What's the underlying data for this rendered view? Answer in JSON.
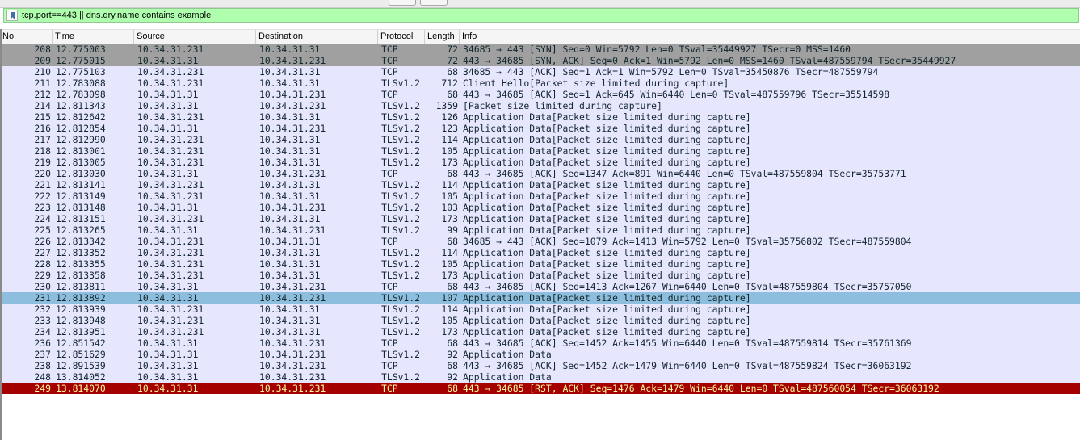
{
  "filter": {
    "value": "tcp.port==443 || dns.qry.name contains example"
  },
  "columns": [
    "No.",
    "Time",
    "Source",
    "Destination",
    "Protocol",
    "Length",
    "Info"
  ],
  "colors": {
    "filter_bg": "#afffaf",
    "tcp_bg": "#e7e6ff",
    "syn_bg": "#a0a0a0",
    "selected_bg": "#8ebedd",
    "rst_bg": "#a40000",
    "rst_fg": "#fffc9c"
  },
  "packets": [
    {
      "no": "208",
      "time": "12.775003",
      "src": "10.34.31.231",
      "dst": "10.34.31.31",
      "proto": "TCP",
      "len": "72",
      "info": "34685 → 443 [SYN] Seq=0 Win=5792 Len=0 TSval=35449927 TSecr=0 MSS=1460",
      "style": "syn"
    },
    {
      "no": "209",
      "time": "12.775015",
      "src": "10.34.31.31",
      "dst": "10.34.31.231",
      "proto": "TCP",
      "len": "72",
      "info": "443 → 34685 [SYN, ACK] Seq=0 Ack=1 Win=5792 Len=0 MSS=1460 TSval=487559794 TSecr=35449927",
      "style": "syn"
    },
    {
      "no": "210",
      "time": "12.775103",
      "src": "10.34.31.231",
      "dst": "10.34.31.31",
      "proto": "TCP",
      "len": "68",
      "info": "34685 → 443 [ACK] Seq=1 Ack=1 Win=5792 Len=0 TSval=35450876 TSecr=487559794",
      "style": "tcp"
    },
    {
      "no": "211",
      "time": "12.783088",
      "src": "10.34.31.231",
      "dst": "10.34.31.31",
      "proto": "TLSv1.2",
      "len": "712",
      "info": "Client Hello[Packet size limited during capture]",
      "style": "tls"
    },
    {
      "no": "212",
      "time": "12.783098",
      "src": "10.34.31.31",
      "dst": "10.34.31.231",
      "proto": "TCP",
      "len": "68",
      "info": "443 → 34685 [ACK] Seq=1 Ack=645 Win=6440 Len=0 TSval=487559796 TSecr=35514598",
      "style": "tcp"
    },
    {
      "no": "214",
      "time": "12.811343",
      "src": "10.34.31.31",
      "dst": "10.34.31.231",
      "proto": "TLSv1.2",
      "len": "1359",
      "info": "[Packet size limited during capture]",
      "style": "tls"
    },
    {
      "no": "215",
      "time": "12.812642",
      "src": "10.34.31.231",
      "dst": "10.34.31.31",
      "proto": "TLSv1.2",
      "len": "126",
      "info": "Application Data[Packet size limited during capture]",
      "style": "tls"
    },
    {
      "no": "216",
      "time": "12.812854",
      "src": "10.34.31.31",
      "dst": "10.34.31.231",
      "proto": "TLSv1.2",
      "len": "123",
      "info": "Application Data[Packet size limited during capture]",
      "style": "tls"
    },
    {
      "no": "217",
      "time": "12.812990",
      "src": "10.34.31.231",
      "dst": "10.34.31.31",
      "proto": "TLSv1.2",
      "len": "114",
      "info": "Application Data[Packet size limited during capture]",
      "style": "tls"
    },
    {
      "no": "218",
      "time": "12.813001",
      "src": "10.34.31.231",
      "dst": "10.34.31.31",
      "proto": "TLSv1.2",
      "len": "105",
      "info": "Application Data[Packet size limited during capture]",
      "style": "tls"
    },
    {
      "no": "219",
      "time": "12.813005",
      "src": "10.34.31.231",
      "dst": "10.34.31.31",
      "proto": "TLSv1.2",
      "len": "173",
      "info": "Application Data[Packet size limited during capture]",
      "style": "tls"
    },
    {
      "no": "220",
      "time": "12.813030",
      "src": "10.34.31.31",
      "dst": "10.34.31.231",
      "proto": "TCP",
      "len": "68",
      "info": "443 → 34685 [ACK] Seq=1347 Ack=891 Win=6440 Len=0 TSval=487559804 TSecr=35753771",
      "style": "tcp"
    },
    {
      "no": "221",
      "time": "12.813141",
      "src": "10.34.31.231",
      "dst": "10.34.31.31",
      "proto": "TLSv1.2",
      "len": "114",
      "info": "Application Data[Packet size limited during capture]",
      "style": "tls"
    },
    {
      "no": "222",
      "time": "12.813149",
      "src": "10.34.31.231",
      "dst": "10.34.31.31",
      "proto": "TLSv1.2",
      "len": "105",
      "info": "Application Data[Packet size limited during capture]",
      "style": "tls"
    },
    {
      "no": "223",
      "time": "12.813148",
      "src": "10.34.31.31",
      "dst": "10.34.31.231",
      "proto": "TLSv1.2",
      "len": "103",
      "info": "Application Data[Packet size limited during capture]",
      "style": "tls"
    },
    {
      "no": "224",
      "time": "12.813151",
      "src": "10.34.31.231",
      "dst": "10.34.31.31",
      "proto": "TLSv1.2",
      "len": "173",
      "info": "Application Data[Packet size limited during capture]",
      "style": "tls"
    },
    {
      "no": "225",
      "time": "12.813265",
      "src": "10.34.31.31",
      "dst": "10.34.31.231",
      "proto": "TLSv1.2",
      "len": "99",
      "info": "Application Data[Packet size limited during capture]",
      "style": "tls"
    },
    {
      "no": "226",
      "time": "12.813342",
      "src": "10.34.31.231",
      "dst": "10.34.31.31",
      "proto": "TCP",
      "len": "68",
      "info": "34685 → 443 [ACK] Seq=1079 Ack=1413 Win=5792 Len=0 TSval=35756802 TSecr=487559804",
      "style": "tcp"
    },
    {
      "no": "227",
      "time": "12.813352",
      "src": "10.34.31.231",
      "dst": "10.34.31.31",
      "proto": "TLSv1.2",
      "len": "114",
      "info": "Application Data[Packet size limited during capture]",
      "style": "tls"
    },
    {
      "no": "228",
      "time": "12.813355",
      "src": "10.34.31.231",
      "dst": "10.34.31.31",
      "proto": "TLSv1.2",
      "len": "105",
      "info": "Application Data[Packet size limited during capture]",
      "style": "tls"
    },
    {
      "no": "229",
      "time": "12.813358",
      "src": "10.34.31.231",
      "dst": "10.34.31.31",
      "proto": "TLSv1.2",
      "len": "173",
      "info": "Application Data[Packet size limited during capture]",
      "style": "tls"
    },
    {
      "no": "230",
      "time": "12.813811",
      "src": "10.34.31.31",
      "dst": "10.34.31.231",
      "proto": "TCP",
      "len": "68",
      "info": "443 → 34685 [ACK] Seq=1413 Ack=1267 Win=6440 Len=0 TSval=487559804 TSecr=35757050",
      "style": "tcp"
    },
    {
      "no": "231",
      "time": "12.813892",
      "src": "10.34.31.31",
      "dst": "10.34.31.231",
      "proto": "TLSv1.2",
      "len": "107",
      "info": "Application Data[Packet size limited during capture]",
      "style": "sel"
    },
    {
      "no": "232",
      "time": "12.813939",
      "src": "10.34.31.231",
      "dst": "10.34.31.31",
      "proto": "TLSv1.2",
      "len": "114",
      "info": "Application Data[Packet size limited during capture]",
      "style": "tls"
    },
    {
      "no": "233",
      "time": "12.813948",
      "src": "10.34.31.231",
      "dst": "10.34.31.31",
      "proto": "TLSv1.2",
      "len": "105",
      "info": "Application Data[Packet size limited during capture]",
      "style": "tls"
    },
    {
      "no": "234",
      "time": "12.813951",
      "src": "10.34.31.231",
      "dst": "10.34.31.31",
      "proto": "TLSv1.2",
      "len": "173",
      "info": "Application Data[Packet size limited during capture]",
      "style": "tls"
    },
    {
      "no": "236",
      "time": "12.851542",
      "src": "10.34.31.31",
      "dst": "10.34.31.231",
      "proto": "TCP",
      "len": "68",
      "info": "443 → 34685 [ACK] Seq=1452 Ack=1455 Win=6440 Len=0 TSval=487559814 TSecr=35761369",
      "style": "tcp"
    },
    {
      "no": "237",
      "time": "12.851629",
      "src": "10.34.31.31",
      "dst": "10.34.31.231",
      "proto": "TLSv1.2",
      "len": "92",
      "info": "Application Data",
      "style": "tls"
    },
    {
      "no": "238",
      "time": "12.891539",
      "src": "10.34.31.31",
      "dst": "10.34.31.231",
      "proto": "TCP",
      "len": "68",
      "info": "443 → 34685 [ACK] Seq=1452 Ack=1479 Win=6440 Len=0 TSval=487559824 TSecr=36063192",
      "style": "tcp"
    },
    {
      "no": "248",
      "time": "13.814052",
      "src": "10.34.31.31",
      "dst": "10.34.31.231",
      "proto": "TLSv1.2",
      "len": "92",
      "info": "Application Data",
      "style": "tls"
    },
    {
      "no": "249",
      "time": "13.814070",
      "src": "10.34.31.31",
      "dst": "10.34.31.231",
      "proto": "TCP",
      "len": "68",
      "info": "443 → 34685 [RST, ACK] Seq=1476 Ack=1479 Win=6440 Len=0 TSval=487560054 TSecr=36063192",
      "style": "rst"
    }
  ]
}
